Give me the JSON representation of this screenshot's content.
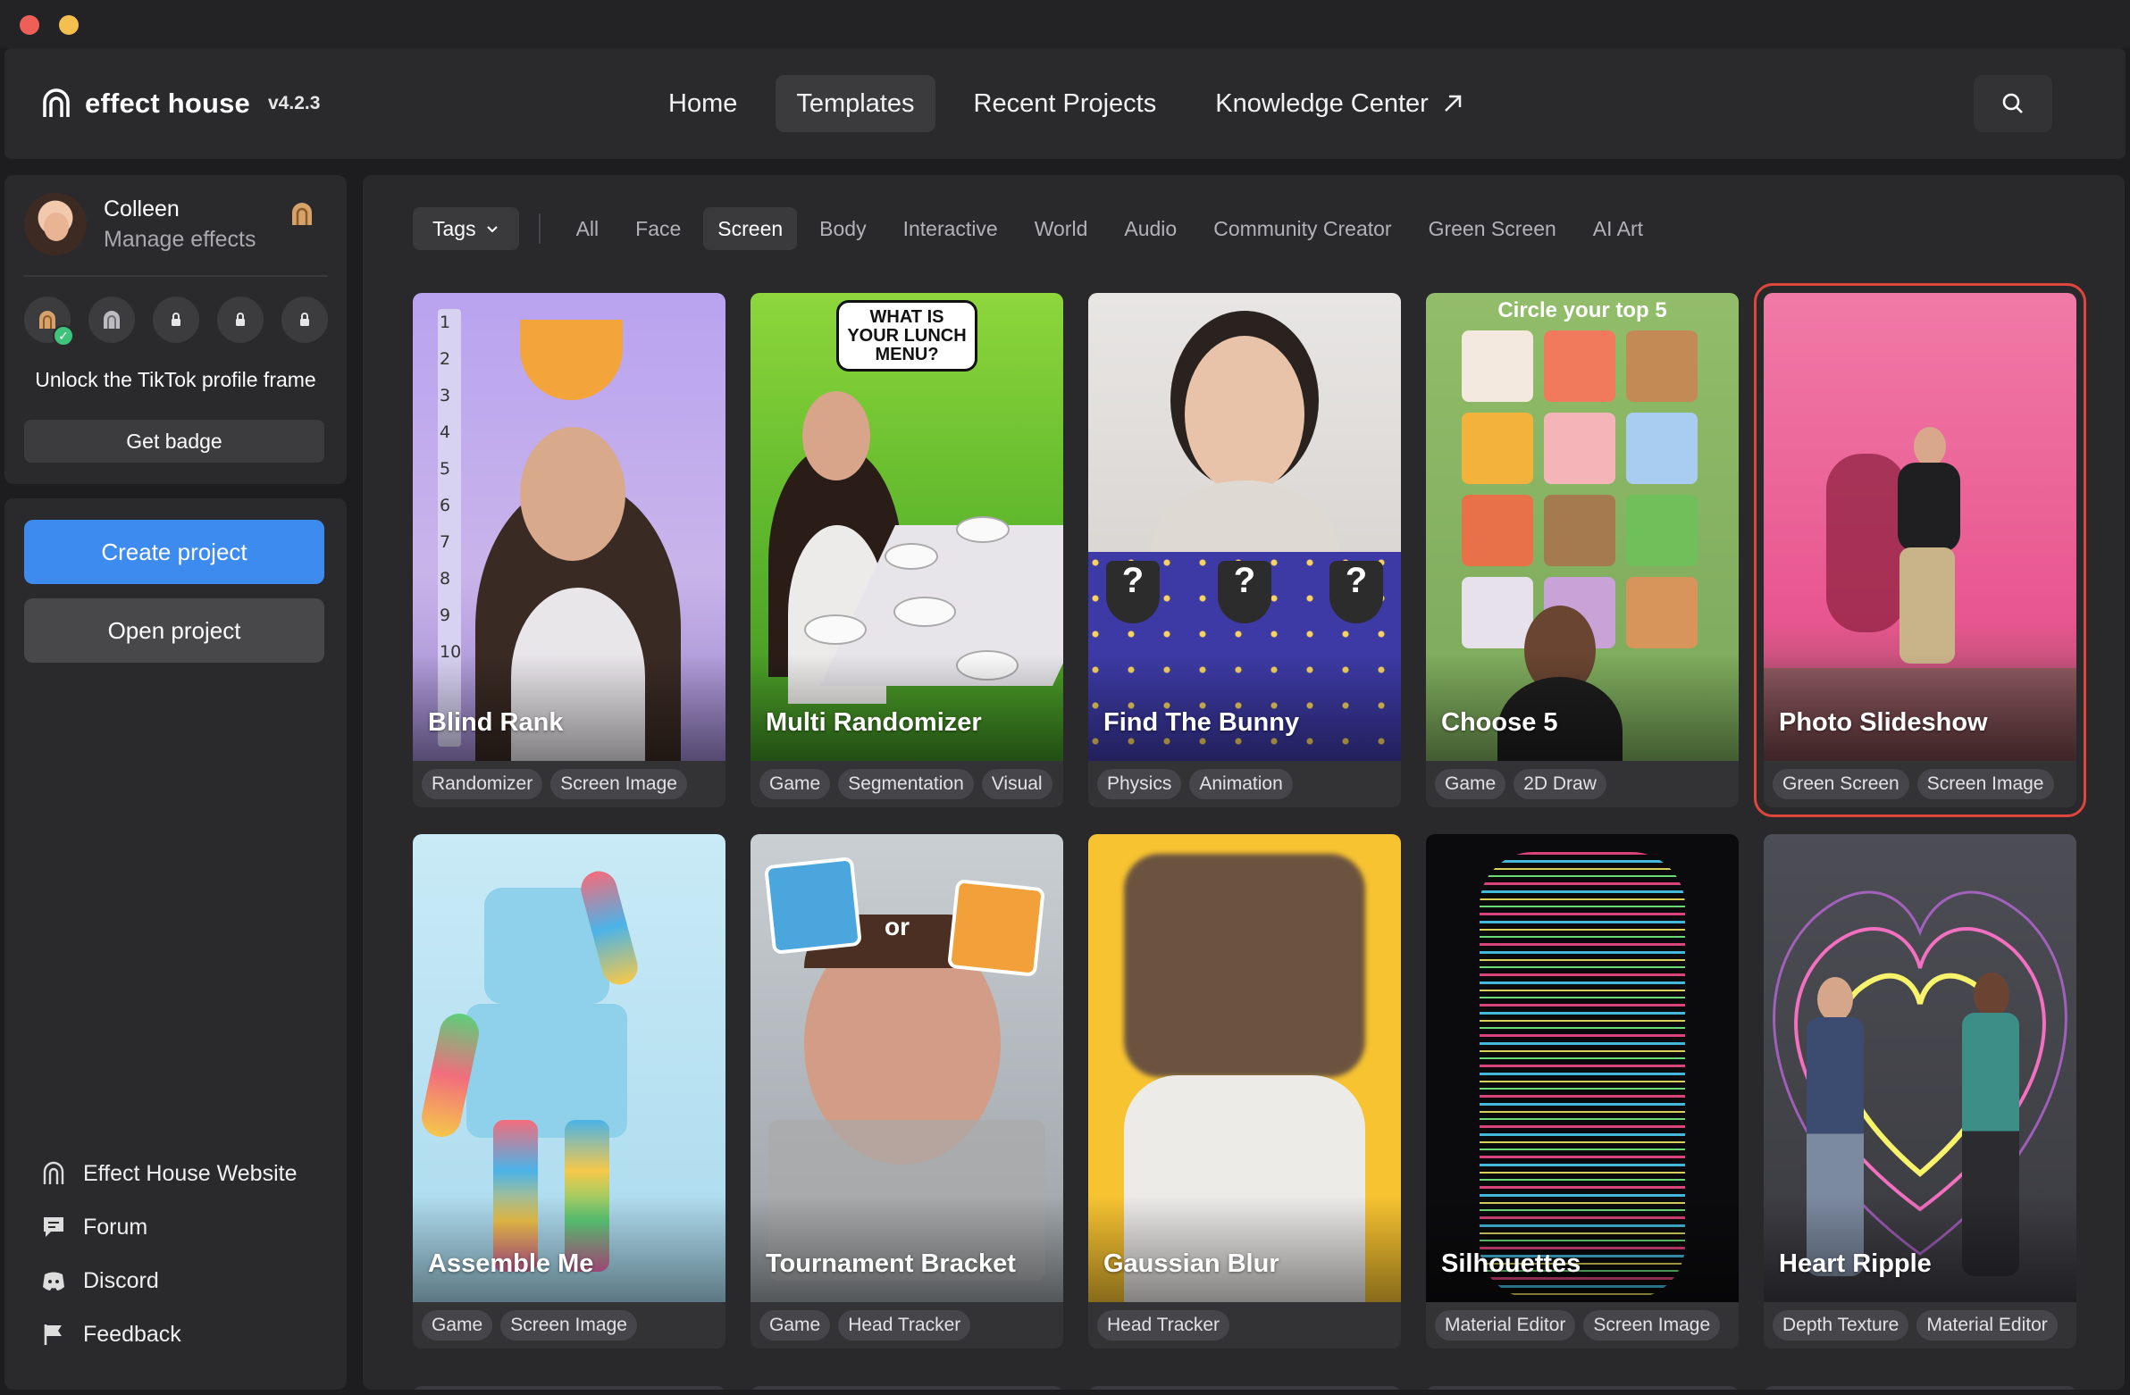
{
  "app": {
    "name": "effect house",
    "version": "v4.2.3"
  },
  "nav": {
    "items": [
      {
        "label": "Home",
        "active": false
      },
      {
        "label": "Templates",
        "active": true
      },
      {
        "label": "Recent Projects",
        "active": false
      },
      {
        "label": "Knowledge Center",
        "active": false,
        "icon": "external-link-icon"
      }
    ],
    "search_icon": "search-icon"
  },
  "profile": {
    "name": "Colleen",
    "subtitle": "Manage effects",
    "badges": [
      {
        "icon": "arch-icon",
        "earned": true
      },
      {
        "icon": "arch-icon",
        "earned": false
      },
      {
        "icon": "lock-icon",
        "earned": false
      },
      {
        "icon": "lock-icon",
        "earned": false
      },
      {
        "icon": "lock-icon",
        "earned": false
      }
    ],
    "unlock_text": "Unlock the TikTok profile frame",
    "get_badge_label": "Get badge"
  },
  "actions": {
    "create_label": "Create project",
    "open_label": "Open project"
  },
  "links": [
    {
      "label": "Effect House Website",
      "icon": "arch-icon"
    },
    {
      "label": "Forum",
      "icon": "forum-icon"
    },
    {
      "label": "Discord",
      "icon": "discord-icon"
    },
    {
      "label": "Feedback",
      "icon": "flag-icon"
    }
  ],
  "filters": {
    "tags_label": "Tags",
    "categories": [
      "All",
      "Face",
      "Screen",
      "Body",
      "Interactive",
      "World",
      "Audio",
      "Community Creator",
      "Green Screen",
      "AI Art"
    ],
    "active": "Screen"
  },
  "templates": [
    {
      "title": "Blind Rank",
      "tags": [
        "Randomizer",
        "Screen Image"
      ]
    },
    {
      "title": "Multi Randomizer",
      "tags": [
        "Game",
        "Segmentation",
        "Visual"
      ]
    },
    {
      "title": "Find The Bunny",
      "tags": [
        "Physics",
        "Animation"
      ]
    },
    {
      "title": "Choose 5",
      "tags": [
        "Game",
        "2D Draw"
      ]
    },
    {
      "title": "Photo Slideshow",
      "tags": [
        "Green Screen",
        "Screen Image"
      ],
      "selected": true
    },
    {
      "title": "Assemble Me",
      "tags": [
        "Game",
        "Screen Image"
      ]
    },
    {
      "title": "Tournament Bracket",
      "tags": [
        "Game",
        "Head Tracker"
      ]
    },
    {
      "title": "Gaussian Blur",
      "tags": [
        "Head Tracker"
      ]
    },
    {
      "title": "Silhouettes",
      "tags": [
        "Material Editor",
        "Screen Image"
      ]
    },
    {
      "title": "Heart Ripple",
      "tags": [
        "Depth Texture",
        "Material Editor"
      ]
    }
  ],
  "thumb_text": {
    "multi_bubble": "WHAT IS YOUR LUNCH MENU?",
    "choose_banner": "Circle your top 5",
    "tourn_or": "or",
    "blind_numbers": [
      "1",
      "2",
      "3",
      "4",
      "5",
      "6",
      "7",
      "8",
      "9",
      "10"
    ]
  },
  "colors": {
    "accent": "#3e8bf0",
    "selection": "#e0463b",
    "earned_check": "#3fc27a"
  }
}
